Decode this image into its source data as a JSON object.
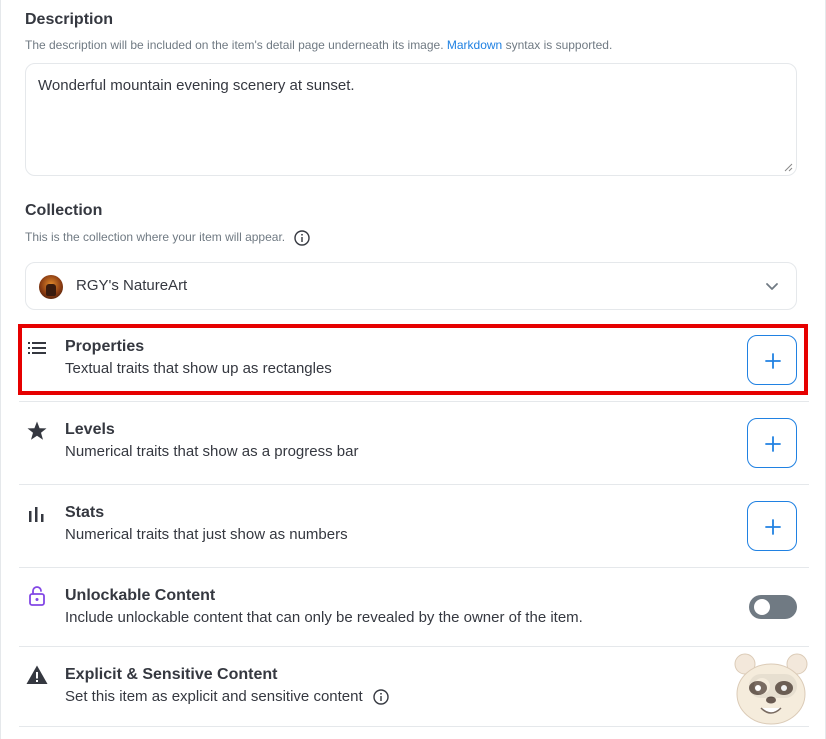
{
  "description": {
    "label": "Description",
    "hint_prefix": "The description will be included on the item's detail page underneath its image. ",
    "hint_link": "Markdown",
    "hint_suffix": " syntax is supported.",
    "value": "Wonderful mountain evening scenery at sunset."
  },
  "collection": {
    "label": "Collection",
    "hint": "This is the collection where your item will appear.",
    "selected": "RGY's NatureArt"
  },
  "traits": [
    {
      "icon": "list-icon",
      "title": "Properties",
      "desc": "Textual traits that show up as rectangles",
      "action": "+"
    },
    {
      "icon": "star-icon",
      "title": "Levels",
      "desc": "Numerical traits that show as a progress bar",
      "action": "+"
    },
    {
      "icon": "bar-chart-icon",
      "title": "Stats",
      "desc": "Numerical traits that just show as numbers",
      "action": "+"
    }
  ],
  "unlockable": {
    "icon": "lock-icon",
    "title": "Unlockable Content",
    "desc": "Include unlockable content that can only be revealed by the owner of the item.",
    "enabled": false
  },
  "explicit": {
    "icon": "warning-icon",
    "title": "Explicit & Sensitive Content",
    "desc": "Set this item as explicit and sensitive content",
    "enabled": false
  },
  "colors": {
    "accent": "#2081e2",
    "highlight": "#e60000",
    "toggle_off": "#707a83"
  }
}
